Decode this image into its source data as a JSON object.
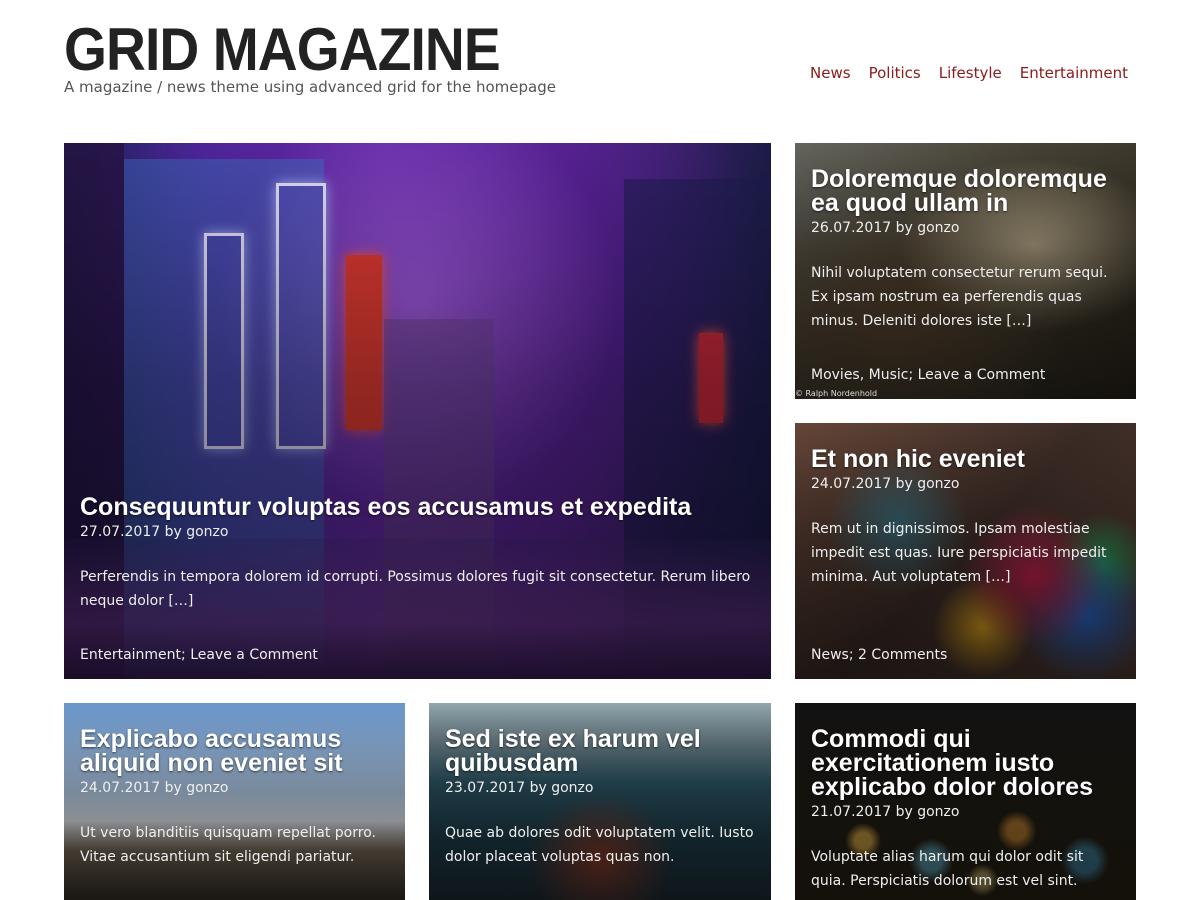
{
  "header": {
    "title": "GRID MAGAZINE",
    "tagline": "A magazine / news theme using advanced grid for the homepage"
  },
  "nav": {
    "items": [
      {
        "label": "News"
      },
      {
        "label": "Politics"
      },
      {
        "label": "Lifestyle"
      },
      {
        "label": "Entertainment"
      }
    ]
  },
  "posts": {
    "featured": {
      "title": "Consequuntur voluptas eos accusamus et expedita",
      "meta": "27.07.2017 by gonzo",
      "excerpt": "Perferendis in tempora dolorem id corrupti. Possimus dolores fugit sit consectetur. Rerum libero neque dolor […]",
      "footer": "Entertainment; Leave a Comment"
    },
    "side1": {
      "title": "Doloremque doloremque ea quod ullam in",
      "meta": "26.07.2017 by gonzo",
      "excerpt": "Nihil voluptatem consectetur rerum sequi. Ex ipsam nostrum ea perferendis quas minus. Deleniti dolores iste […]",
      "footer": "Movies, Music; Leave a Comment",
      "credit": "© Ralph Nordenhold"
    },
    "side2": {
      "title": "Et non hic eveniet",
      "meta": "24.07.2017 by gonzo",
      "excerpt": "Rem ut in dignissimos. Ipsam molestiae impedit est quas. Iure perspiciatis impedit minima. Aut voluptatem […]",
      "footer": "News; 2 Comments"
    },
    "bottom1": {
      "title": "Explicabo accusamus aliquid non eveniet sit",
      "meta": "24.07.2017 by gonzo",
      "excerpt": "Ut vero blanditiis quisquam repellat porro. Vitae accusantium sit eligendi pariatur."
    },
    "bottom2": {
      "title": "Sed iste ex harum vel quibusdam",
      "meta": "23.07.2017 by gonzo",
      "excerpt": "Quae ab dolores odit voluptatem velit. Iusto dolor placeat voluptas quas non."
    },
    "bottom3": {
      "title": "Commodi qui exercitationem iusto explicabo dolor dolores",
      "meta": "21.07.2017 by gonzo",
      "excerpt": "Voluptate alias harum qui dolor odit sit quia. Perspiciatis dolorum est vel sint."
    }
  }
}
